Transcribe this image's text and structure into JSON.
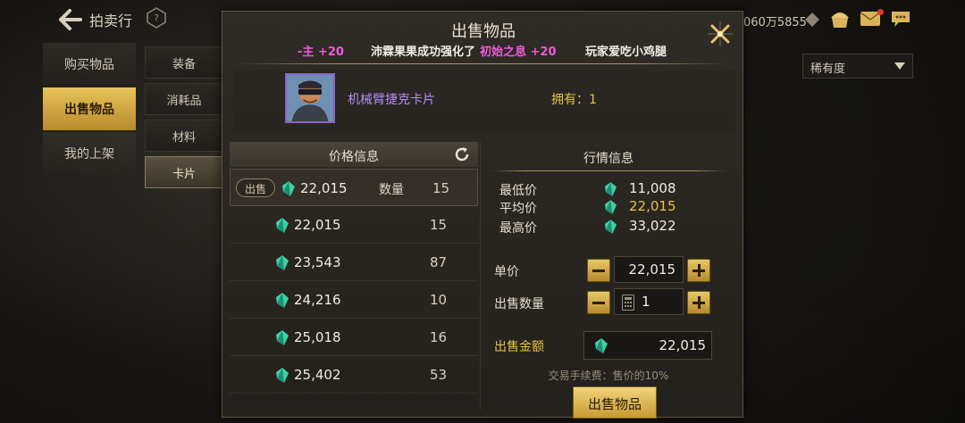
{
  "header": {
    "title": "拍卖行",
    "currency_amount": "060万5855"
  },
  "nav_primary": [
    {
      "label": "购买物品",
      "active": false
    },
    {
      "label": "出售物品",
      "active": true
    },
    {
      "label": "我的上架",
      "active": false
    }
  ],
  "nav_secondary": [
    {
      "label": "装备",
      "active": false
    },
    {
      "label": "消耗品",
      "active": false
    },
    {
      "label": "材料",
      "active": false
    },
    {
      "label": "卡片",
      "active": true
    }
  ],
  "sort": {
    "selected": "稀有度"
  },
  "modal": {
    "title": "出售物品",
    "ticker": {
      "part1": "-主 +20",
      "part2": "沛霖果果成功强化了",
      "part3": "初始之息 +20",
      "part4": "玩家爱吃小鸡腿"
    },
    "item": {
      "name": "机械臂捷克卡片",
      "owned_label": "拥有：1"
    },
    "price_panel": {
      "header": "价格信息",
      "sell_tag": "出售",
      "qty_label": "数量",
      "rows": [
        {
          "price": "22,015",
          "qty": "15"
        },
        {
          "price": "22,015",
          "qty": "15"
        },
        {
          "price": "23,543",
          "qty": "87"
        },
        {
          "price": "24,216",
          "qty": "10"
        },
        {
          "price": "25,018",
          "qty": "16"
        },
        {
          "price": "25,402",
          "qty": "53"
        }
      ]
    },
    "market": {
      "header": "行情信息",
      "min_label": "最低价",
      "min_value": "11,008",
      "avg_label": "平均价",
      "avg_value": "22,015",
      "max_label": "最高价",
      "max_value": "33,022",
      "unit_price_label": "单价",
      "unit_price_value": "22,015",
      "quantity_label": "出售数量",
      "quantity_value": "1",
      "total_label": "出售金额",
      "total_value": "22,015",
      "fee_note": "交易手续费：售价的10%",
      "sell_button": "出售物品"
    }
  },
  "colors": {
    "gold": "#e6c14b",
    "purple_name": "#b48cf2",
    "ticker_pink": "#ef5bd9",
    "gem": "#3fd1a6"
  }
}
